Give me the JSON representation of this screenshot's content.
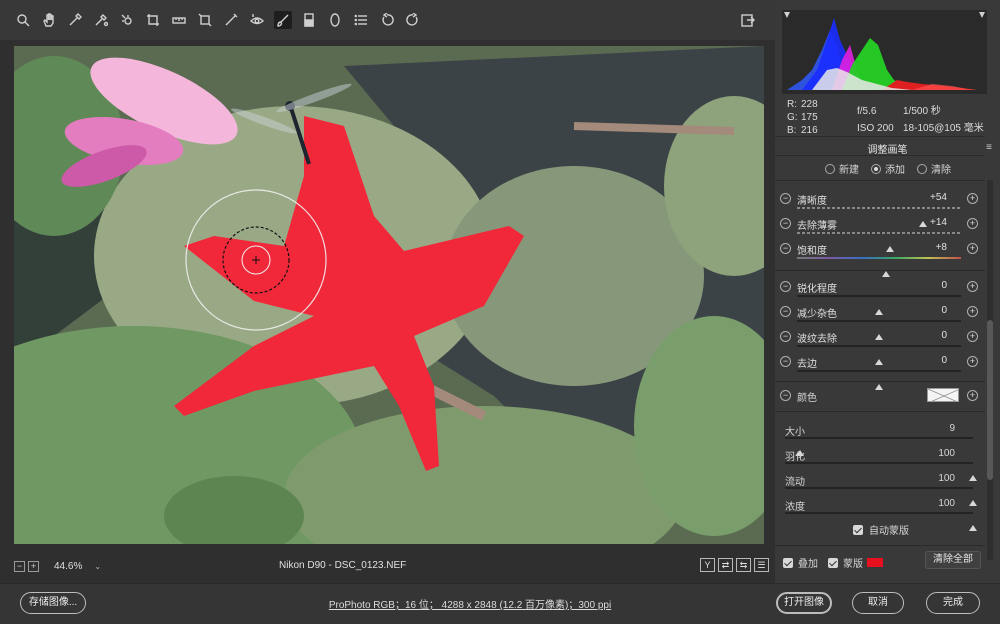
{
  "toolbar": {
    "tools": [
      {
        "name": "zoom-tool-icon"
      },
      {
        "name": "hand-tool-icon"
      },
      {
        "name": "white-balance-tool-icon"
      },
      {
        "name": "color-sampler-tool-icon"
      },
      {
        "name": "targeted-adjustment-tool-icon"
      },
      {
        "name": "crop-tool-icon"
      },
      {
        "name": "straighten-tool-icon"
      },
      {
        "name": "transform-tool-icon"
      },
      {
        "name": "spot-removal-tool-icon"
      },
      {
        "name": "red-eye-tool-icon"
      },
      {
        "name": "adjustment-brush-tool-icon"
      },
      {
        "name": "graduated-filter-tool-icon"
      },
      {
        "name": "radial-filter-tool-icon"
      },
      {
        "name": "preferences-icon"
      },
      {
        "name": "rotate-left-icon"
      },
      {
        "name": "rotate-right-icon"
      }
    ],
    "active_tool": "adjustment-brush-tool-icon"
  },
  "status": {
    "zoom_out": "−",
    "zoom_in": "+",
    "zoom": "44.6%",
    "zoom_dropdown": "⌄",
    "filename": "Nikon D90 -  DSC_0123.NEF",
    "view_buttons": [
      "Y",
      "⇄",
      "⇆",
      "☰"
    ]
  },
  "info": {
    "r_label": "R:",
    "r": "228",
    "g_label": "G:",
    "g": "175",
    "b_label": "B:",
    "b": "216",
    "aperture": "f/5.6",
    "shutter": "1/500 秒",
    "iso": "ISO 200",
    "lens": "18-105@105 毫米"
  },
  "panel": {
    "title": "调整画笔",
    "menu_icon": "≡",
    "modes": [
      {
        "label": "新建",
        "selected": false
      },
      {
        "label": "添加",
        "selected": true
      },
      {
        "label": "清除",
        "selected": false
      }
    ],
    "sliders": [
      {
        "label": "清晰度",
        "value": "+54",
        "level": 0.77
      },
      {
        "label": "去除薄雾",
        "value": "+14",
        "level": 0.57
      },
      {
        "label": "饱和度",
        "value": "+8",
        "level": 0.54
      },
      {
        "label": "锐化程度",
        "value": "0",
        "level": 0.5
      },
      {
        "label": "减少杂色",
        "value": "0",
        "level": 0.5
      },
      {
        "label": "波纹去除",
        "value": "0",
        "level": 0.5
      },
      {
        "label": "去边",
        "value": "0",
        "level": 0.5
      }
    ],
    "color": {
      "label": "颜色"
    },
    "brush": [
      {
        "label": "大小",
        "value": "9",
        "level": 0.08
      },
      {
        "label": "羽化",
        "value": "100",
        "level": 1.0
      },
      {
        "label": "流动",
        "value": "100",
        "level": 1.0
      },
      {
        "label": "浓度",
        "value": "100",
        "level": 1.0
      }
    ],
    "auto_mask": "自动蒙版",
    "overlay": "叠加",
    "mask": "蒙版",
    "mask_color": "#e8101e",
    "clear_all": "清除全部"
  },
  "footer": {
    "save": "存储图像...",
    "info": "ProPhoto RGB；16 位；  4288 x 2848 (12.2 百万像素)；300 ppi",
    "open": "打开图像",
    "cancel": "取消",
    "done": "完成"
  }
}
